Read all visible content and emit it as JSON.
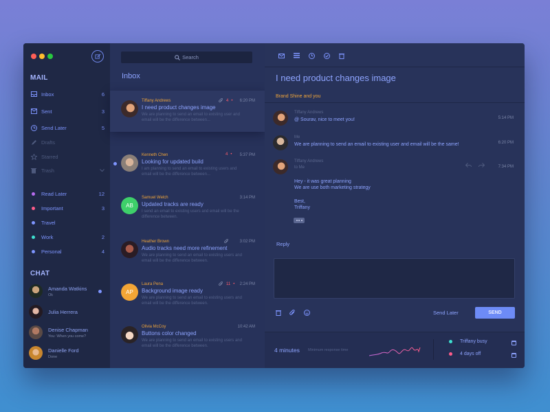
{
  "sidebar": {
    "mail_title": "MAIL",
    "mail_items": [
      {
        "label": "Inbox",
        "count": "6",
        "icon": "inbox-icon",
        "active": true
      },
      {
        "label": "Sent",
        "count": "3",
        "icon": "sent-icon",
        "active": true
      },
      {
        "label": "Send Later",
        "count": "5",
        "icon": "clock-icon",
        "active": true
      },
      {
        "label": "Drafts",
        "count": "",
        "icon": "pencil-icon",
        "active": false
      },
      {
        "label": "Starred",
        "count": "",
        "icon": "star-icon",
        "active": false
      },
      {
        "label": "Trash",
        "count": "",
        "icon": "trash-icon",
        "active": false
      }
    ],
    "labels": [
      {
        "label": "Read Later",
        "count": "12",
        "color": "#b86cf0"
      },
      {
        "label": "Important",
        "count": "3",
        "color": "#ff5c8a"
      },
      {
        "label": "Travel",
        "count": "",
        "color": "#7e95ff"
      },
      {
        "label": "Work",
        "count": "2",
        "color": "#3ee0d0"
      },
      {
        "label": "Personal",
        "count": "4",
        "color": "#7e95ff"
      }
    ],
    "chat_title": "CHAT",
    "chats": [
      {
        "name": "Amanda Watkins",
        "sub": "Ok",
        "online": true
      },
      {
        "name": "Julia Herrera",
        "sub": "",
        "online": false
      },
      {
        "name": "Denise Chapman",
        "sub": "You:  When you come?",
        "online": false
      },
      {
        "name": "Danielle Ford",
        "sub": "Done",
        "online": false
      }
    ]
  },
  "list": {
    "search_label": "Search",
    "title": "Inbox",
    "messages": [
      {
        "from": "Tiffany Andrews",
        "subject": "I need product changes image",
        "preview": "We are planning to send an email to existing user and email will be the difference between...",
        "time": "6:20 PM",
        "count": "4",
        "attach": true
      },
      {
        "from": "Kenneth Chen",
        "subject": "Looking for updated build",
        "preview": "I am planning to send an email to existing users and email will be the difference between...",
        "time": "5:37 PM",
        "count": "4",
        "attach": false
      },
      {
        "from": "Samuel Welch",
        "subject": "Updated tracks are ready",
        "preview": "I send an email to existing users and email will be the difference between.",
        "time": "3:14 PM",
        "count": "",
        "attach": false,
        "initials": "AB"
      },
      {
        "from": "Heather Brown",
        "subject": "Audio tracks need more refinement",
        "preview": "We are planning to send an email to existing users and email will be the difference between.",
        "time": "3:02 PM",
        "count": "",
        "attach": true
      },
      {
        "from": "Laura Pena",
        "subject": "Background image ready",
        "preview": "We are planning to send an email to existing users and email will be the difference between.",
        "time": "2:24 PM",
        "count": "11",
        "attach": true,
        "initials": "AP"
      },
      {
        "from": "Olivia McCoy",
        "subject": "Buttons color changed",
        "preview": "We are planning to send an email to existing users and email will be the difference between.",
        "time": "10:42 AM",
        "count": "",
        "attach": false
      }
    ]
  },
  "pane": {
    "subject": "I need product changes image",
    "participants": "Brand Shine and you",
    "thread": [
      {
        "sender": "Tiffany Andrews",
        "lines": [
          "@ Sourav, nice to meet you!"
        ],
        "time": "5:14 PM"
      },
      {
        "sender": "Me",
        "lines": [
          "We are planning to send an email to existing user and email will be the same!"
        ],
        "time": "6:20 PM"
      },
      {
        "sender": "Tiffany Andrews",
        "to": "to Me",
        "lines": [
          "Hey - it was great planning",
          "We are use both marketing strategy",
          "",
          "Best,",
          "Triffany"
        ],
        "time": "7:34 PM"
      }
    ],
    "reply_label": "Reply",
    "send_later": "Send Later",
    "send": "SEND",
    "stats": {
      "value": "4 minutes",
      "label": "Minimum response time"
    },
    "status": [
      {
        "label": "Triffany busy",
        "color": "#3ee0d0"
      },
      {
        "label": "4 days off",
        "color": "#ff5c8a"
      }
    ]
  }
}
